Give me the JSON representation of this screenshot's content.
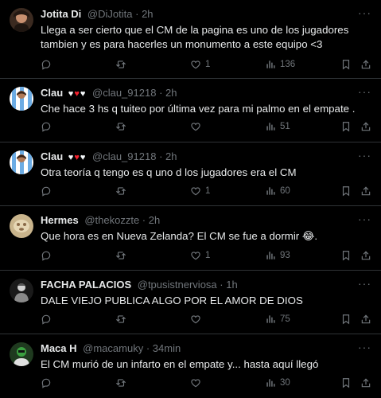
{
  "tweets": [
    {
      "name": "Jotita Di",
      "hearts": false,
      "handle": "@DiJotita",
      "dot": "·",
      "time": "2h",
      "text": "Llega a ser cierto que el CM de la pagina es uno de los jugadores tambien y es para hacerles un monumento a este equipo <3",
      "likes": "1",
      "views": "136",
      "avatar_colors": [
        "#3b2a20",
        "#c89070"
      ]
    },
    {
      "name": "Clau",
      "hearts": true,
      "handle": "@clau_91218",
      "dot": "·",
      "time": "2h",
      "text": "Che hace 3 hs q tuiteo por última vez para mi palmo en el empate .",
      "likes": "",
      "views": "51",
      "avatar_colors": [
        "#6cace4",
        "#ffffff"
      ]
    },
    {
      "name": "Clau",
      "hearts": true,
      "handle": "@clau_91218",
      "dot": "·",
      "time": "2h",
      "text": "Otra teoría q tengo es q uno d los jugadores era el CM",
      "likes": "1",
      "views": "60",
      "avatar_colors": [
        "#6cace4",
        "#ffffff"
      ]
    },
    {
      "name": "Hermes",
      "hearts": false,
      "handle": "@thekozzte",
      "dot": "·",
      "time": "2h",
      "text": "Que hora es en Nueva Zelanda? El CM se fue a dormir 😂.",
      "likes": "1",
      "views": "93",
      "avatar_colors": [
        "#c9b48c",
        "#8a6a48"
      ]
    },
    {
      "name": "FACHA PALACIOS",
      "hearts": false,
      "handle": "@tpusistnerviosa",
      "dot": "·",
      "time": "1h",
      "text": "DALE VIEJO PUBLICA ALGO POR EL AMOR DE DIOS",
      "likes": "",
      "views": "75",
      "avatar_colors": [
        "#1a1a1a",
        "#d0d0d0"
      ]
    },
    {
      "name": "Maca H",
      "hearts": false,
      "handle": "@macamuky",
      "dot": "·",
      "time": "34min",
      "text": "El CM murió de un infarto en el empate y... hasta aquí llegó",
      "likes": "",
      "views": "30",
      "avatar_colors": [
        "#1f3a1f",
        "#3aa040"
      ]
    }
  ],
  "icons": {
    "reply": "reply-icon",
    "retweet": "retweet-icon",
    "like": "like-icon",
    "views": "views-icon",
    "bookmark": "bookmark-icon",
    "share": "share-icon",
    "more": "more-icon"
  },
  "more_glyph": "···",
  "colors": {
    "background": "#000000",
    "text": "#e7e9ea",
    "secondary": "#71767b",
    "divider": "#2f3336",
    "heart_red": "#f4212e"
  }
}
